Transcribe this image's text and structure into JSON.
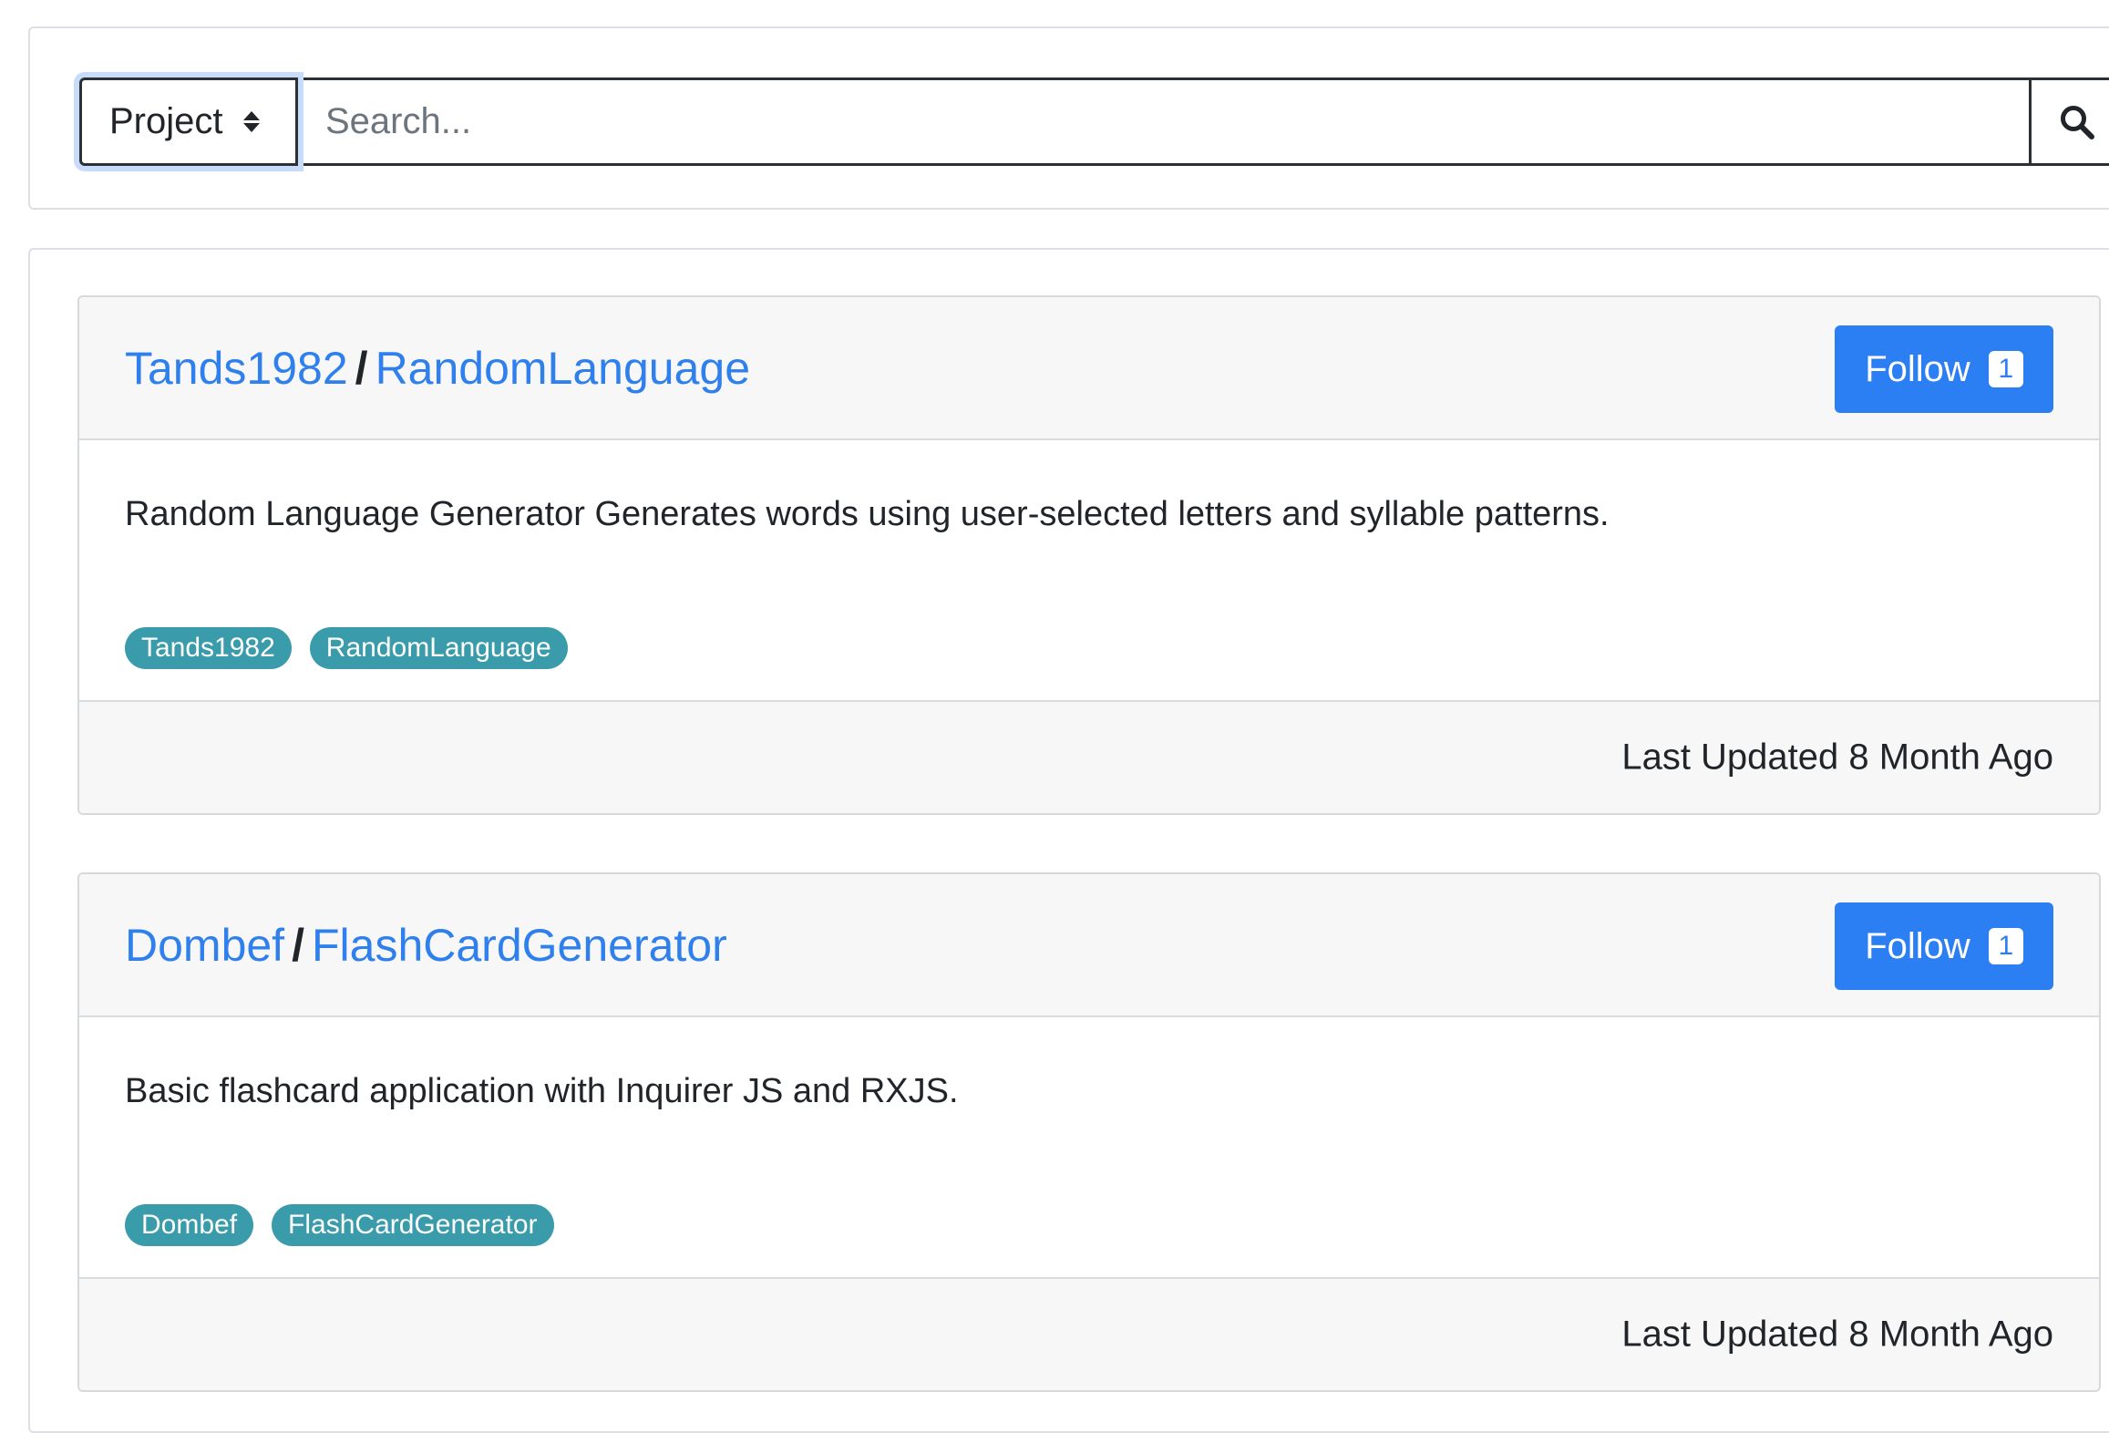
{
  "search": {
    "select_value": "Project",
    "placeholder": "Search..."
  },
  "projects": [
    {
      "owner": "Tands1982",
      "separator": "/",
      "name": "RandomLanguage",
      "follow_label": "Follow",
      "follow_count": "1",
      "description": "Random Language Generator Generates words using user-selected letters and syllable patterns.",
      "tags": [
        "Tands1982",
        "RandomLanguage"
      ],
      "updated": "Last Updated 8 Month Ago"
    },
    {
      "owner": "Dombef",
      "separator": "/",
      "name": "FlashCardGenerator",
      "follow_label": "Follow",
      "follow_count": "1",
      "description": "Basic flashcard application with Inquirer JS and RXJS.",
      "tags": [
        "Dombef",
        "FlashCardGenerator"
      ],
      "updated": "Last Updated 8 Month Ago"
    }
  ],
  "colors": {
    "link": "#2f80ed",
    "primary": "#2c7ef3",
    "tag": "#3a9cab"
  },
  "icons": {
    "search": "search-icon",
    "select": "sort-arrows-icon"
  }
}
